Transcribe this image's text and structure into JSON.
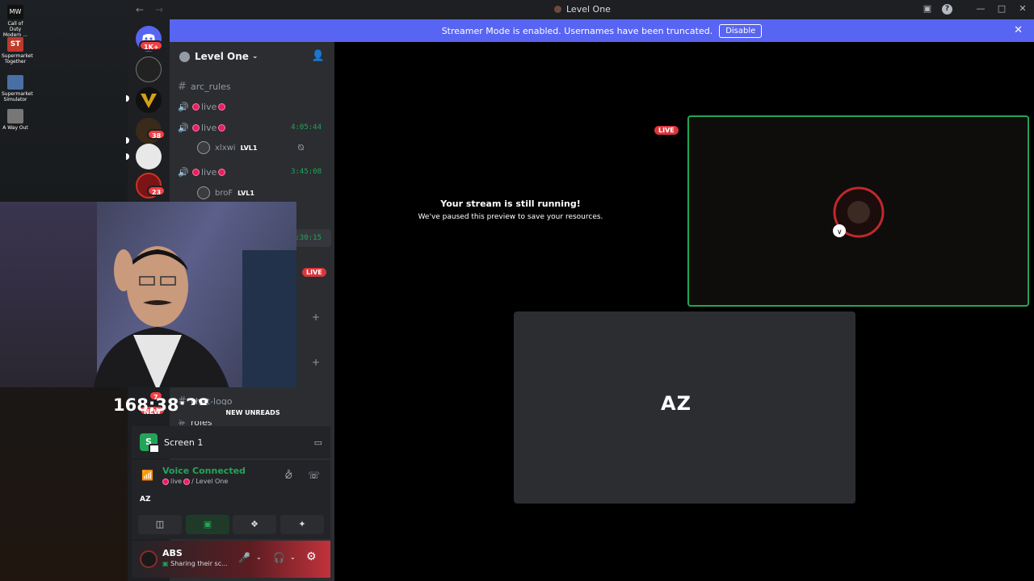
{
  "desktop_icons": [
    {
      "label": "Call of Duty Modern ...",
      "color": "#222"
    },
    {
      "label": "Supermarket Together",
      "color": "#c0392b"
    },
    {
      "label": "Supermarket Simulator",
      "color": "#4a6fa5"
    },
    {
      "label": "A Way Out",
      "color": "#666"
    }
  ],
  "window": {
    "title": "Level One"
  },
  "banner": {
    "message": "Streamer Mode is enabled. Usernames have been truncated.",
    "button": "Disable"
  },
  "guild_badges": {
    "home": "1K+",
    "g4": "38",
    "g6": "23",
    "g7": "7",
    "g8": "NEW"
  },
  "server": {
    "name": "Level One"
  },
  "channels": {
    "text1": "arc_rules",
    "voice_label": "live",
    "timer1": "4:05:44",
    "user1": "xlxwi",
    "timer2": "3:45:08",
    "user2": "broF",
    "lvl": "LVL1",
    "timer3": "1:30:15",
    "live": "LIVE",
    "text2": "chat-logo",
    "text3": "roles"
  },
  "stopwatch": "168:38:28",
  "new_unreads": "NEW UNREADS",
  "screen": {
    "icon_letter": "S",
    "label": "Screen 1"
  },
  "voice": {
    "title": "Voice Connected",
    "channel": "live",
    "server": "/ Level One",
    "logo": "AZ"
  },
  "user_panel": {
    "name": "ABS",
    "status": "Sharing their sc..."
  },
  "stream": {
    "paused_title": "Your stream is still running!",
    "paused_sub": "We've paused this preview to save your resources.",
    "live": "LIVE",
    "tile_logo": "AZ"
  }
}
